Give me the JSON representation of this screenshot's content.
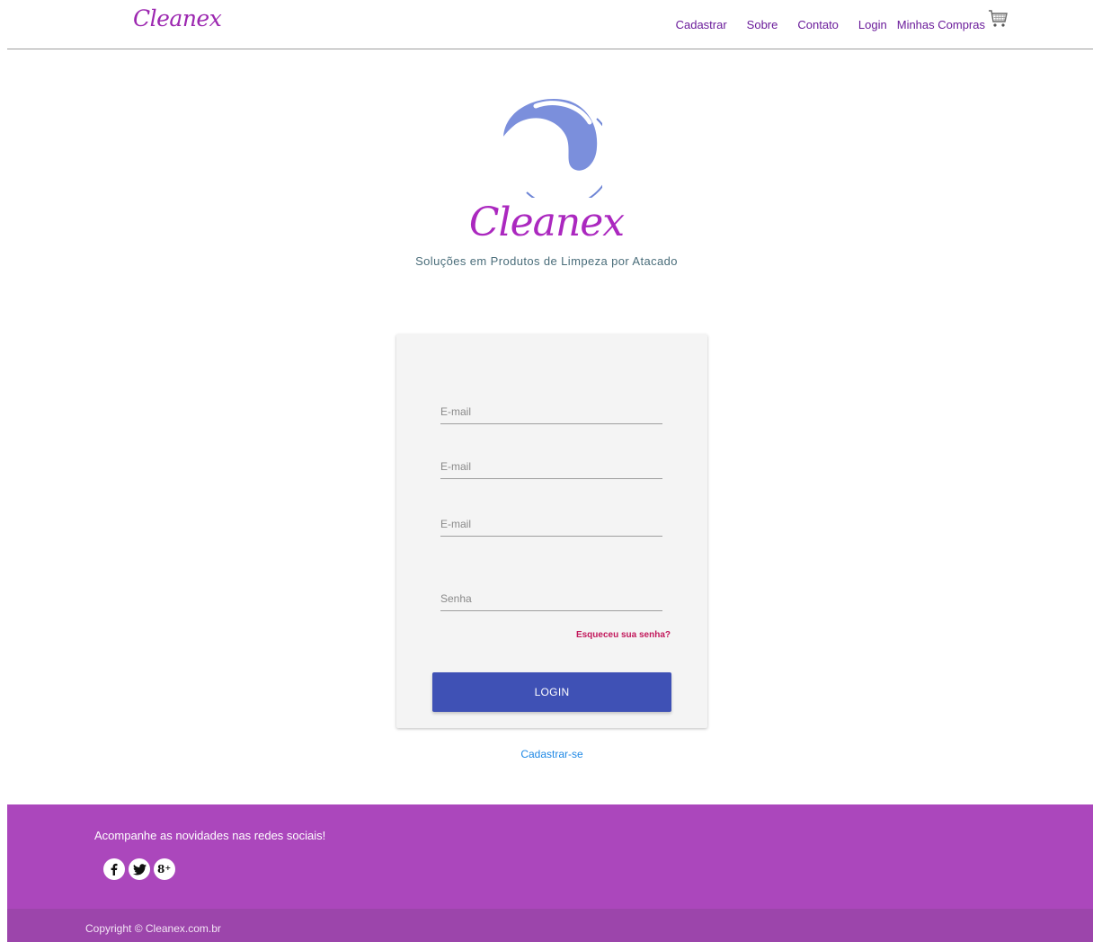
{
  "header": {
    "brand": "Cleanex",
    "nav": [
      {
        "label": "Cadastrar"
      },
      {
        "label": "Sobre"
      },
      {
        "label": "Contato"
      },
      {
        "label": "Login"
      },
      {
        "label": "Minhas Compras"
      }
    ],
    "cart_icon": "shopping-cart-icon"
  },
  "hero": {
    "logo_icon": "wave-circle-logo",
    "title": "Cleanex",
    "subtitle": "Soluções em Produtos de Limpeza por Atacado"
  },
  "login_form": {
    "fields": [
      {
        "placeholder": "E-mail",
        "value": ""
      },
      {
        "placeholder": "E-mail",
        "value": ""
      },
      {
        "placeholder": "E-mail",
        "value": ""
      },
      {
        "placeholder": "Senha",
        "value": ""
      }
    ],
    "forgot_label": "Esqueceu sua senha?",
    "submit_label": "LOGIN"
  },
  "register_label": "Cadastrar-se",
  "footer": {
    "social_text": "Acompanhe as novidades nas redes sociais!",
    "socials": [
      {
        "icon": "facebook-icon",
        "glyph": "f"
      },
      {
        "icon": "twitter-icon",
        "glyph": "🐦"
      },
      {
        "icon": "google-plus-icon",
        "glyph": "g+"
      }
    ],
    "copyright": "Copyright © Cleanex.com.br"
  },
  "colors": {
    "brand_purple": "#9c27b0",
    "button_blue": "#3f51b5",
    "footer_purple": "#ab47bc",
    "link_red": "#c2185b"
  }
}
